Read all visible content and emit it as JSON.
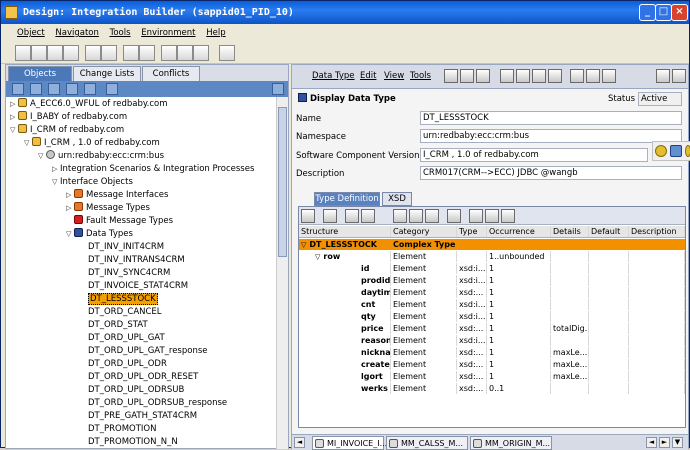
{
  "window": {
    "title": "Design: Integration Builder (sappid01_PID_10)"
  },
  "menu": [
    "Object",
    "Navigaton",
    "Tools",
    "Environment",
    "Help"
  ],
  "left": {
    "tabs": [
      "Objects",
      "Change Lists",
      "Conflicts"
    ],
    "tree": [
      {
        "label": "A_ECC6.0_WFUL of redbaby.com",
        "level": 0,
        "icon": "swc",
        "exp": "▷"
      },
      {
        "label": "I_BABY of redbaby.com",
        "level": 0,
        "icon": "swc",
        "exp": "▷"
      },
      {
        "label": "I_CRM of redbaby.com",
        "level": 0,
        "icon": "swc",
        "exp": "▽"
      },
      {
        "label": "I_CRM , 1.0 of redbaby.com",
        "level": 1,
        "icon": "swc",
        "exp": "▽"
      },
      {
        "label": "urn:redbaby:ecc:crm:bus",
        "level": 2,
        "icon": "pkg",
        "exp": "▽"
      },
      {
        "label": "Integration Scenarios & Integration Processes",
        "level": 3,
        "icon": "",
        "exp": "▷"
      },
      {
        "label": "Interface Objects",
        "level": 3,
        "icon": "",
        "exp": "▽"
      },
      {
        "label": "Message Interfaces",
        "level": 4,
        "icon": "msg",
        "exp": "▷"
      },
      {
        "label": "Message Types",
        "level": 4,
        "icon": "msg",
        "exp": "▷"
      },
      {
        "label": "Fault Message Types",
        "level": 4,
        "icon": "fault",
        "exp": ""
      },
      {
        "label": "Data Types",
        "level": 4,
        "icon": "dt",
        "exp": "▽"
      },
      {
        "label": "DT_INV_INIT4CRM",
        "level": 5,
        "icon": "",
        "exp": ""
      },
      {
        "label": "DT_INV_INTRANS4CRM",
        "level": 5,
        "icon": "",
        "exp": ""
      },
      {
        "label": "DT_INV_SYNC4CRM",
        "level": 5,
        "icon": "",
        "exp": ""
      },
      {
        "label": "DT_INVOICE_STAT4CRM",
        "level": 5,
        "icon": "",
        "exp": ""
      },
      {
        "label": "DT_LESSSTOCK",
        "level": 5,
        "icon": "",
        "exp": "",
        "selected": true
      },
      {
        "label": "DT_ORD_CANCEL",
        "level": 5,
        "icon": "",
        "exp": ""
      },
      {
        "label": "DT_ORD_STAT",
        "level": 5,
        "icon": "",
        "exp": ""
      },
      {
        "label": "DT_ORD_UPL_GAT",
        "level": 5,
        "icon": "",
        "exp": ""
      },
      {
        "label": "DT_ORD_UPL_GAT_response",
        "level": 5,
        "icon": "",
        "exp": ""
      },
      {
        "label": "DT_ORD_UPL_ODR",
        "level": 5,
        "icon": "",
        "exp": ""
      },
      {
        "label": "DT_ORD_UPL_ODR_RESET",
        "level": 5,
        "icon": "",
        "exp": ""
      },
      {
        "label": "DT_ORD_UPL_ODRSUB",
        "level": 5,
        "icon": "",
        "exp": ""
      },
      {
        "label": "DT_ORD_UPL_ODRSUB_response",
        "level": 5,
        "icon": "",
        "exp": ""
      },
      {
        "label": "DT_PRE_GATH_STAT4CRM",
        "level": 5,
        "icon": "",
        "exp": ""
      },
      {
        "label": "DT_PROMOTION",
        "level": 5,
        "icon": "",
        "exp": ""
      },
      {
        "label": "DT_PROMOTION_N_N",
        "level": 5,
        "icon": "",
        "exp": ""
      }
    ]
  },
  "right": {
    "menu": [
      "Data Type",
      "Edit",
      "View",
      "Tools"
    ],
    "heading": "Display Data Type",
    "status_label": "Status",
    "status_value": "Active",
    "fields": {
      "name_label": "Name",
      "name_value": "DT_LESSSTOCK",
      "ns_label": "Namespace",
      "ns_value": "urn:redbaby:ecc:crm:bus",
      "swcv_label": "Software Component Version",
      "swcv_value": "I_CRM , 1.0 of redbaby.com",
      "desc_label": "Description",
      "desc_value": "CRM017(CRM-->ECC) JDBC @wangb"
    },
    "type_tabs": [
      "Type Definition",
      "XSD"
    ],
    "columns": [
      "Structure",
      "Category",
      "Type",
      "Occurrence",
      "Details",
      "Default",
      "Description"
    ],
    "rows": [
      {
        "structure": "DT_LESSSTOCK",
        "category": "Complex Type",
        "type": "",
        "occurrence": "",
        "details": "",
        "indent": 0,
        "exp": "▽",
        "highlight": true
      },
      {
        "structure": "row",
        "category": "Element",
        "type": "",
        "occurrence": "1..unbounded",
        "details": "",
        "indent": 1,
        "exp": "▽"
      },
      {
        "structure": "id",
        "category": "Element",
        "type": "xsd:i...",
        "occurrence": "1",
        "details": "",
        "indent": 2
      },
      {
        "structure": "prodid",
        "category": "Element",
        "type": "xsd:i...",
        "occurrence": "1",
        "details": "",
        "indent": 2
      },
      {
        "structure": "daytime",
        "category": "Element",
        "type": "xsd:...",
        "occurrence": "1",
        "details": "",
        "indent": 2
      },
      {
        "structure": "cnt",
        "category": "Element",
        "type": "xsd:i...",
        "occurrence": "1",
        "details": "",
        "indent": 2
      },
      {
        "structure": "qty",
        "category": "Element",
        "type": "xsd:i...",
        "occurrence": "1",
        "details": "",
        "indent": 2
      },
      {
        "structure": "price",
        "category": "Element",
        "type": "xsd:...",
        "occurrence": "1",
        "details": "totalDig...",
        "indent": 2
      },
      {
        "structure": "reason_id",
        "category": "Element",
        "type": "xsd:i...",
        "occurrence": "1",
        "details": "",
        "indent": 2
      },
      {
        "structure": "nickname",
        "category": "Element",
        "type": "xsd:...",
        "occurrence": "1",
        "details": "maxLe...",
        "indent": 2
      },
      {
        "structure": "create_user",
        "category": "Element",
        "type": "xsd:...",
        "occurrence": "1",
        "details": "maxLe...",
        "indent": 2
      },
      {
        "structure": "lgort",
        "category": "Element",
        "type": "xsd:...",
        "occurrence": "1",
        "details": "maxLe...",
        "indent": 2
      },
      {
        "structure": "werks",
        "category": "Element",
        "type": "xsd:...",
        "occurrence": "0..1",
        "details": "",
        "indent": 2
      }
    ],
    "bottom_tabs": [
      "MI_INVOICE_I...",
      "MM_CALSS_M...",
      "MM_ORIGIN_M..."
    ]
  },
  "colors": {
    "accent": "#4a78b8",
    "highlight": "#f29000",
    "selection": "#f4a000"
  }
}
